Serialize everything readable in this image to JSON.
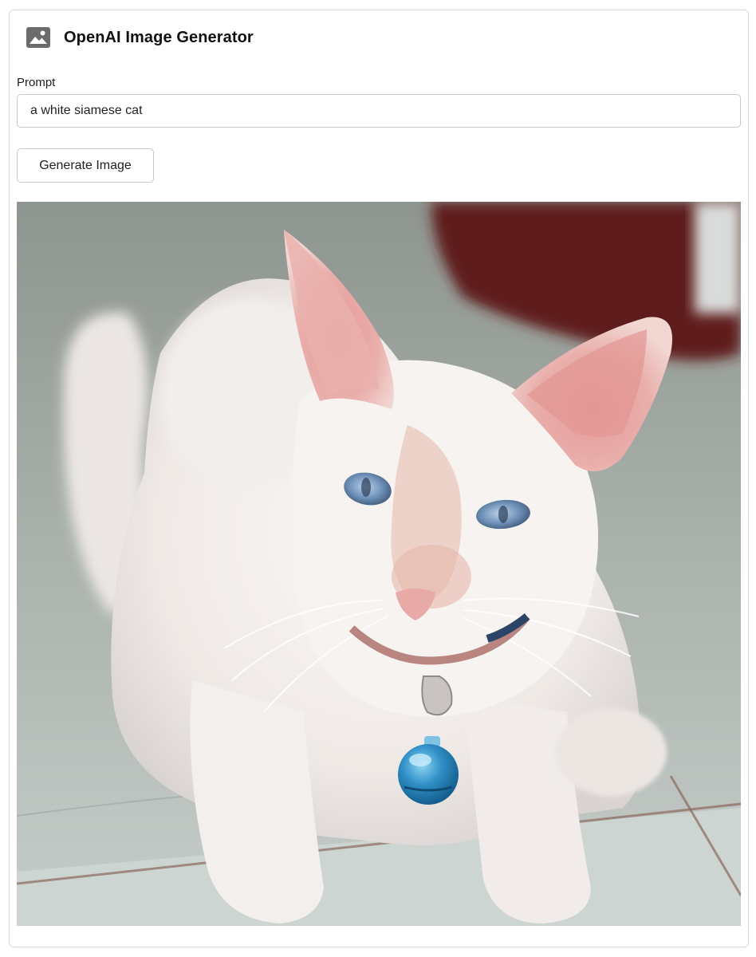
{
  "app": {
    "title": "OpenAI Image Generator",
    "icon": "image-icon"
  },
  "prompt": {
    "label": "Prompt",
    "value": "a white siamese cat"
  },
  "actions": {
    "generate_label": "Generate Image"
  },
  "result": {
    "image_subject": "white siamese cat with blue eyes and blue collar bell"
  },
  "colors": {
    "border": "#c8c8c8",
    "icon": "#6b6b6b",
    "bell": "#2f8fc6"
  }
}
